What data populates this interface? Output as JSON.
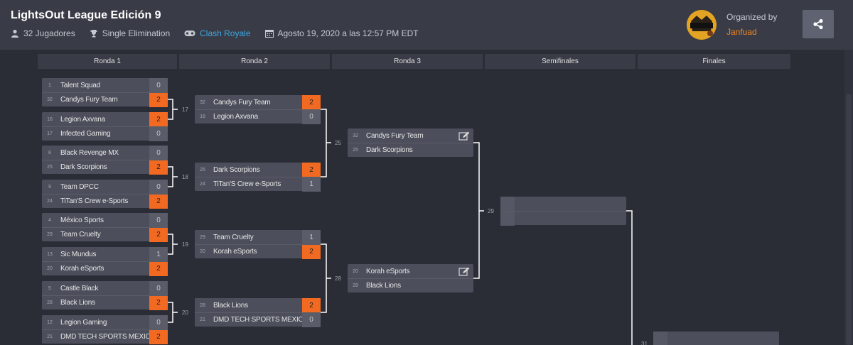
{
  "header": {
    "title": "LightsOut League Edición 9",
    "players": "32 Jugadores",
    "format": "Single Elimination",
    "game": "Clash Royale",
    "date": "Agosto 19, 2020 a las 12:57 PM EDT",
    "organized_by_label": "Organized by",
    "organizer": "Janfuad"
  },
  "rounds": [
    "Ronda 1",
    "Ronda 2",
    "Ronda 3",
    "Semifinales",
    "Finales"
  ],
  "matches": {
    "r1": [
      {
        "a": {
          "seed": "1",
          "name": "Talent Squad",
          "score": "0"
        },
        "b": {
          "seed": "32",
          "name": "Candys Fury Team",
          "score": "2"
        }
      },
      {
        "a": {
          "seed": "16",
          "name": "Legion Axvana",
          "score": "2"
        },
        "b": {
          "seed": "17",
          "name": "Infected Gaming",
          "score": "0"
        }
      },
      {
        "a": {
          "seed": "8",
          "name": "Black Revenge MX",
          "score": "0"
        },
        "b": {
          "seed": "25",
          "name": "Dark Scorpions",
          "score": "2"
        }
      },
      {
        "a": {
          "seed": "9",
          "name": "Team DPCC",
          "score": "0"
        },
        "b": {
          "seed": "24",
          "name": "TiTan'S Crew e-Sports",
          "score": "2"
        }
      },
      {
        "a": {
          "seed": "4",
          "name": "México Sports",
          "score": "0"
        },
        "b": {
          "seed": "29",
          "name": "Team Cruelty",
          "score": "2"
        }
      },
      {
        "a": {
          "seed": "13",
          "name": "Sic Mundus",
          "score": "1"
        },
        "b": {
          "seed": "20",
          "name": "Korah eSports",
          "score": "2"
        }
      },
      {
        "a": {
          "seed": "5",
          "name": "Castle Black",
          "score": "0"
        },
        "b": {
          "seed": "28",
          "name": "Black Lions",
          "score": "2"
        }
      },
      {
        "a": {
          "seed": "12",
          "name": "Legion Gaming",
          "score": "0"
        },
        "b": {
          "seed": "21",
          "name": "DMD TECH SPORTS MÉXICO",
          "score": "2"
        }
      }
    ],
    "r2": [
      {
        "num": "17",
        "a": {
          "seed": "32",
          "name": "Candys Fury Team",
          "score": "2"
        },
        "b": {
          "seed": "16",
          "name": "Legion Axvana",
          "score": "0"
        }
      },
      {
        "num": "18",
        "a": {
          "seed": "25",
          "name": "Dark Scorpions",
          "score": "2"
        },
        "b": {
          "seed": "24",
          "name": "TiTan'S Crew e-Sports",
          "score": "1"
        }
      },
      {
        "num": "19",
        "a": {
          "seed": "29",
          "name": "Team Cruelty",
          "score": "1"
        },
        "b": {
          "seed": "20",
          "name": "Korah eSports",
          "score": "2"
        }
      },
      {
        "num": "20",
        "a": {
          "seed": "28",
          "name": "Black Lions",
          "score": "2"
        },
        "b": {
          "seed": "21",
          "name": "DMD TECH SPORTS MÉXICO",
          "score": "0"
        }
      }
    ],
    "r3": [
      {
        "num": "25",
        "a": {
          "seed": "32",
          "name": "Candys Fury Team"
        },
        "b": {
          "seed": "25",
          "name": "Dark Scorpions"
        }
      },
      {
        "num": "28",
        "a": {
          "seed": "20",
          "name": "Korah eSports"
        },
        "b": {
          "seed": "28",
          "name": "Black Lions"
        }
      }
    ],
    "semis": [
      {
        "num": "29"
      }
    ],
    "finals": [
      {
        "num": "31"
      }
    ]
  },
  "colors": {
    "win": "#f26a21",
    "link": "#3ea6e3",
    "organizer": "#f28322"
  },
  "icons": [
    "user-icon",
    "trophy-icon",
    "gamepad-icon",
    "calendar-icon",
    "share-icon",
    "edit-icon"
  ]
}
